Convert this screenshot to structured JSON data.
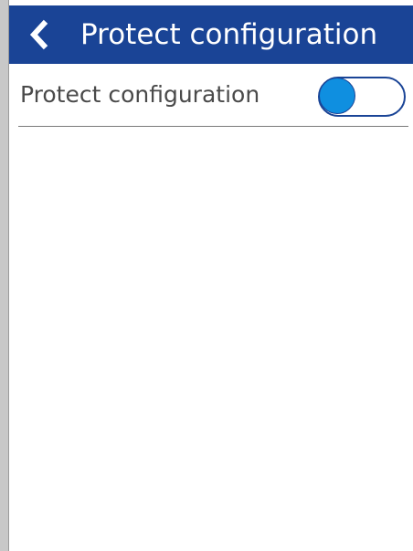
{
  "header": {
    "title": "Protect configuration",
    "back_icon": "chevron-left-icon"
  },
  "settings": {
    "protect_configuration": {
      "label": "Protect configuration",
      "enabled": false
    }
  },
  "colors": {
    "header_bg": "#1a4496",
    "toggle_knob": "#0f8fe0",
    "label_text": "#4a4a4a"
  }
}
